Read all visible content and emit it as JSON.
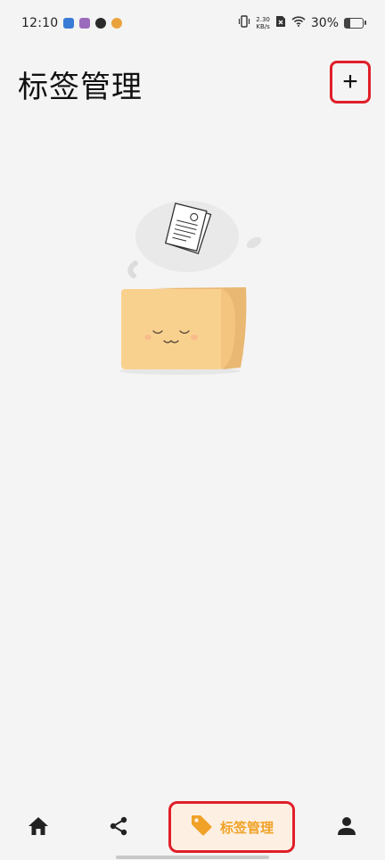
{
  "status_bar": {
    "time": "12:10",
    "net_speed_value": "2.30",
    "net_speed_unit": "KB/s",
    "battery": "30%",
    "battery_level": 0.3
  },
  "header": {
    "title": "标签管理",
    "add_label": "+"
  },
  "bottom_nav": {
    "items": [
      {
        "icon": "home-icon"
      },
      {
        "icon": "share-icon"
      },
      {
        "icon": "tag-icon",
        "label": "标签管理",
        "active": true
      },
      {
        "icon": "person-icon"
      }
    ]
  },
  "colors": {
    "accent": "#f0a228",
    "active_bg": "#fdf0e2",
    "highlight": "#e01f2a",
    "background": "#f4f4f4"
  }
}
